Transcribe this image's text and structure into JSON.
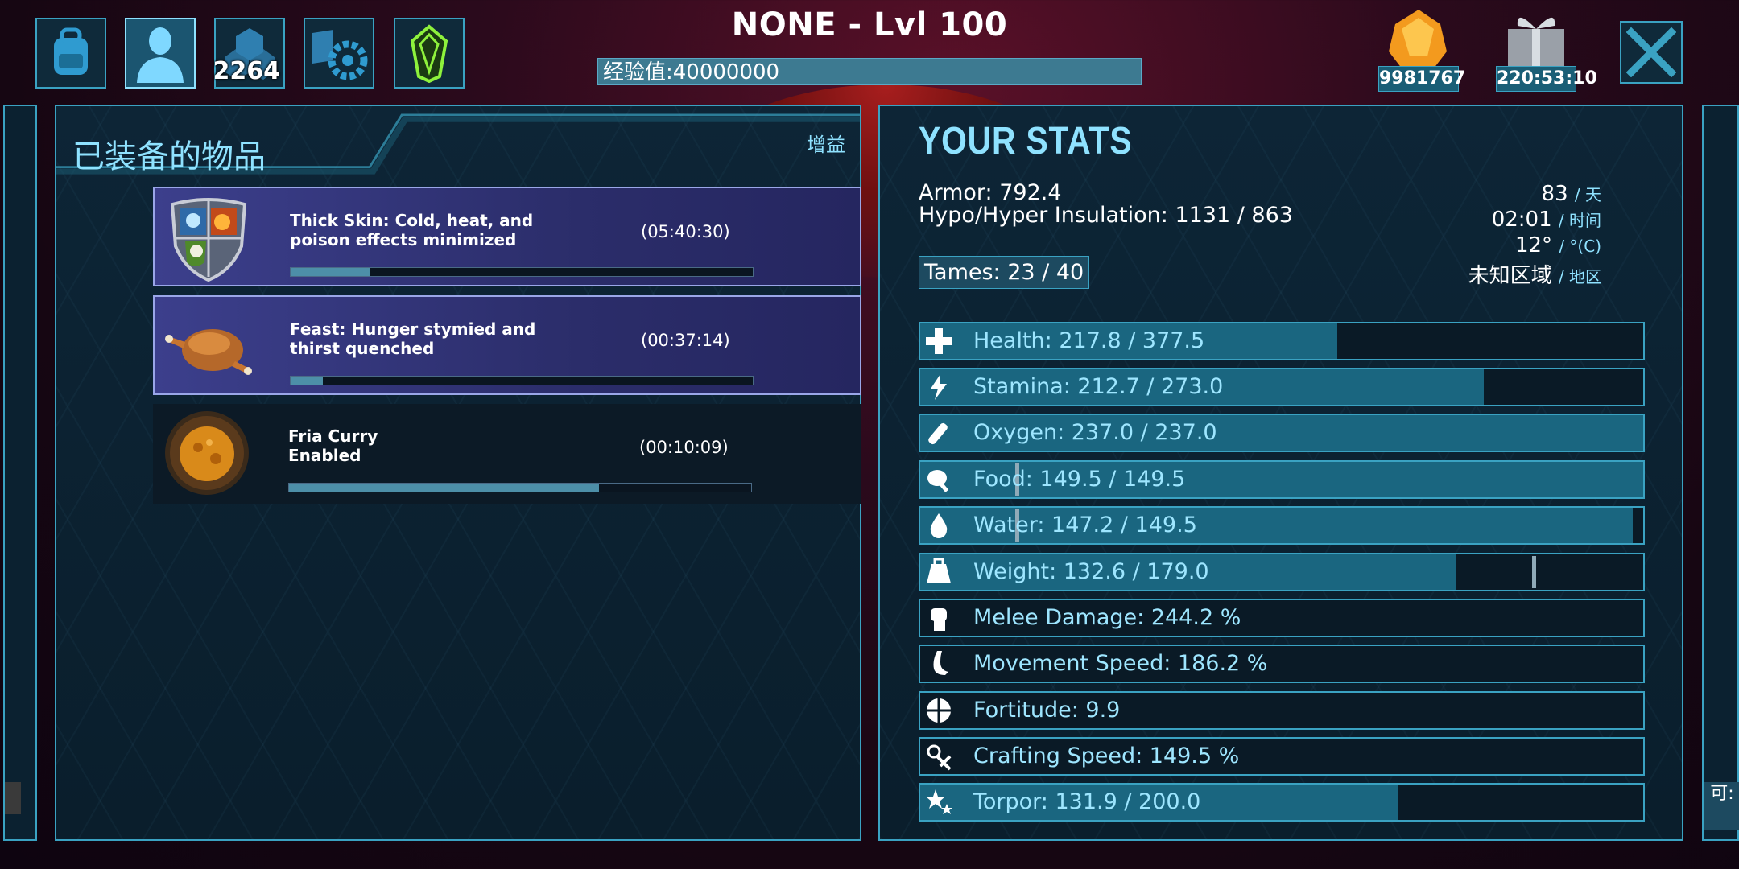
{
  "header": {
    "title": "NONE - Lvl 100",
    "xp_label": "经验值:40000000",
    "engram_points": "2264",
    "resource_amount": "9981767",
    "gift_timer": "220:53:10"
  },
  "top_buttons": [
    {
      "icon": "backpack-icon"
    },
    {
      "icon": "character-icon"
    },
    {
      "icon": "engrams-icon"
    },
    {
      "icon": "settings-book-icon"
    },
    {
      "icon": "crystal-icon"
    }
  ],
  "left_panel": {
    "title": "已装备的物品",
    "buff_tab": "增益",
    "buffs": [
      {
        "name": "Thick Skin: Cold, heat, and poison effects minimized",
        "time": "(05:40:30)",
        "progress": 0.17,
        "icon": "shield-buff-icon"
      },
      {
        "name": "Feast: Hunger stymied and thirst quenched",
        "time": "(00:37:14)",
        "progress": 0.07,
        "icon": "roast-chicken-icon"
      },
      {
        "name": "Fria Curry\nEnabled",
        "name_line1": "Fria Curry",
        "name_line2": "Enabled",
        "time": "(00:10:09)",
        "progress": 0.67,
        "icon": "curry-bowl-icon"
      }
    ]
  },
  "right_panel": {
    "title": "YOUR STATS",
    "armor": "Armor: 792.4",
    "insulation": "Hypo/Hyper Insulation: 1131 / 863",
    "tames": "Tames: 23 / 40",
    "day_value": "83",
    "day_unit": "/ 天",
    "time_value": "02:01",
    "time_unit": "/ 时间",
    "temp_value": "12°",
    "temp_unit": "/ °(C)",
    "region_value": "未知区域",
    "region_unit": "/ 地区",
    "stats": [
      {
        "label": "Health: 217.8 / 377.5",
        "fill": 0.577,
        "icon": "health-cross-icon"
      },
      {
        "label": "Stamina: 212.7 / 273.0",
        "fill": 0.779,
        "icon": "stamina-bolt-icon"
      },
      {
        "label": "Oxygen: 237.0 / 237.0",
        "fill": 1.0,
        "icon": "oxygen-tank-icon"
      },
      {
        "label": "Food: 149.5 / 149.5",
        "fill": 1.0,
        "icon": "food-drumstick-icon"
      },
      {
        "label": "Water: 147.2 / 149.5",
        "fill": 0.985,
        "icon": "water-drop-icon"
      },
      {
        "label": "Weight: 132.6 / 179.0",
        "fill": 0.741,
        "icon": "weight-icon"
      },
      {
        "label": "Melee Damage: 244.2 %",
        "fill": 0,
        "icon": "fist-icon"
      },
      {
        "label": "Movement Speed: 186.2 %",
        "fill": 0,
        "icon": "foot-icon"
      },
      {
        "label": "Fortitude: 9.9",
        "fill": 0,
        "icon": "fortitude-shield-icon"
      },
      {
        "label": "Crafting Speed: 149.5 %",
        "fill": 0,
        "icon": "crafting-tools-icon"
      },
      {
        "label": "Torpor: 131.9 / 200.0",
        "fill": 0.66,
        "icon": "torpor-stars-icon"
      }
    ]
  },
  "right_edge_text": "可:",
  "colors": {
    "accent": "#3aa2c2",
    "label": "#9ee6ff",
    "bar": "#1a6680"
  }
}
